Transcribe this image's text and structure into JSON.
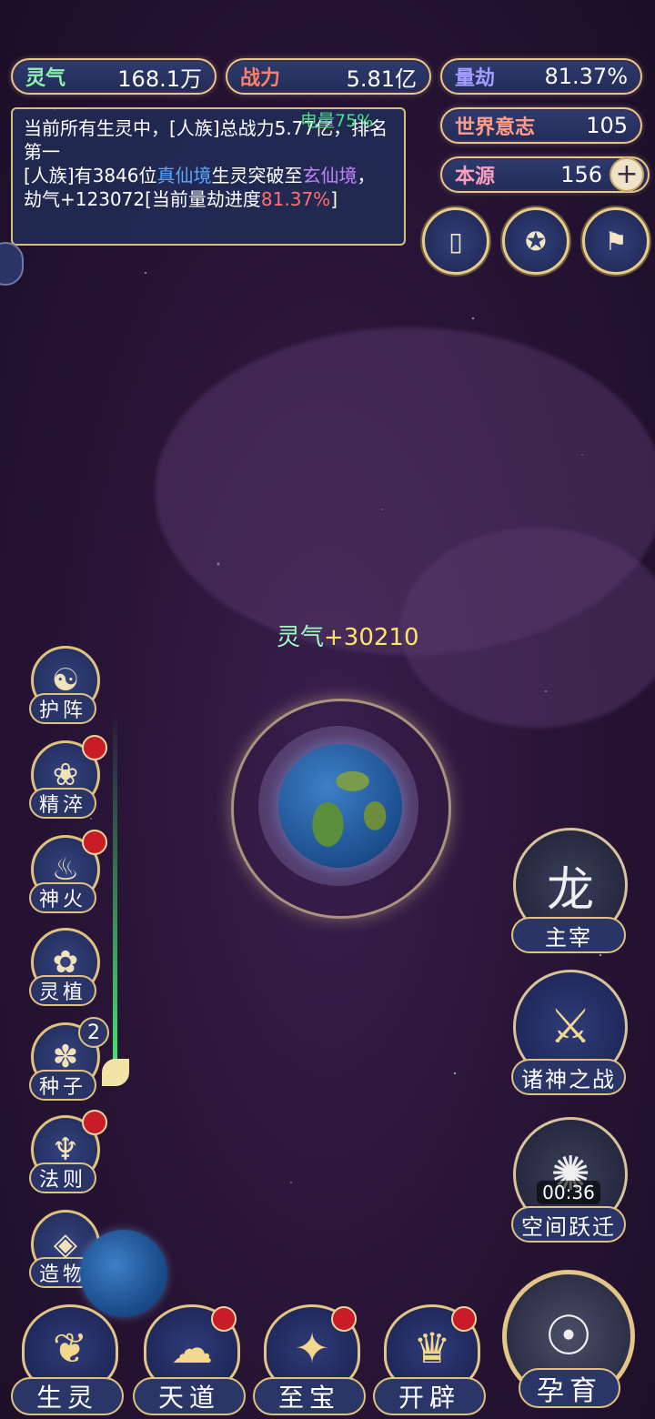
{
  "resources": {
    "lingqi": {
      "label": "灵气",
      "value": "168.1万"
    },
    "zhanli": {
      "label": "战力",
      "value": "5.81亿"
    },
    "liangjie": {
      "label": "量劫",
      "value": "81.37%"
    },
    "shijie": {
      "label": "世界意志",
      "value": "105"
    },
    "benyuan": {
      "label": "本源",
      "value": "156",
      "plus": "+"
    }
  },
  "battery_text": "电量75%",
  "log": {
    "line1": "当前所有生灵中，[人族]总战力5.77亿，排名第一",
    "p2_a": "[人族]有3846位",
    "p2_b": "真仙境",
    "p2_c": "生灵突破至",
    "p2_d": "玄仙境",
    "p2_e": "，劫气+123072[当前量劫进度",
    "p2_f": "81.37%",
    "p2_g": "]"
  },
  "gain": {
    "label": "灵气",
    "value": "+30210"
  },
  "left_menu": [
    {
      "label": "护阵",
      "icon": "☯"
    },
    {
      "label": "精淬",
      "icon": "❀"
    },
    {
      "label": "神火",
      "icon": "♨"
    },
    {
      "label": "灵植",
      "icon": "✿"
    },
    {
      "label": "种子",
      "icon": "✽",
      "count": "2"
    },
    {
      "label": "法则",
      "icon": "♆"
    },
    {
      "label": "造物",
      "icon": "◈"
    }
  ],
  "right_menu": [
    {
      "label": "主宰",
      "icon": "龙"
    },
    {
      "label": "诸神之战",
      "icon": "⚔"
    },
    {
      "label": "空间跃迁",
      "icon": "✺",
      "timer": "00:36"
    }
  ],
  "bottom_tabs": [
    {
      "label": "生灵",
      "icon": "❦"
    },
    {
      "label": "天道",
      "icon": "☁"
    },
    {
      "label": "至宝",
      "icon": "✦"
    },
    {
      "label": "开辟",
      "icon": "♛"
    }
  ],
  "main_action": {
    "label": "孕育",
    "icon": "☉"
  },
  "colors": {
    "gold": "#e6c98a",
    "panel": "#2a3466",
    "red_dot": "#c81d28"
  }
}
